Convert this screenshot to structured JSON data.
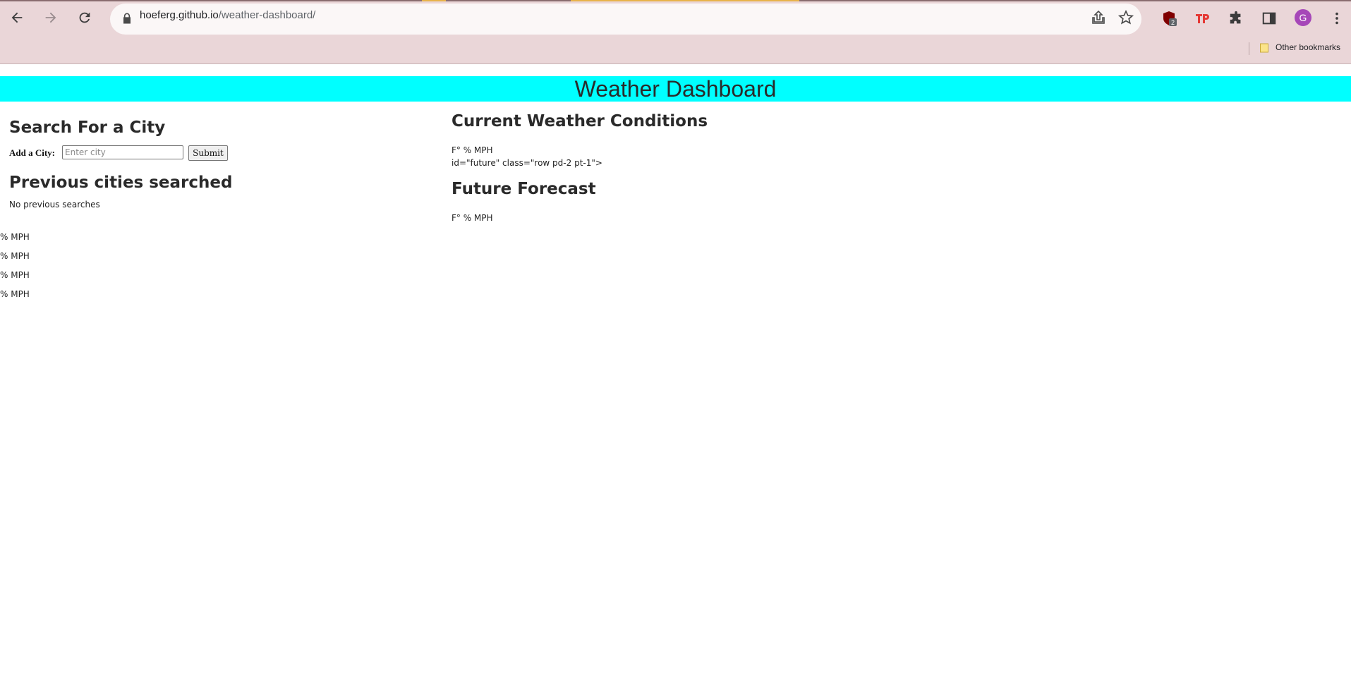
{
  "browser": {
    "url_host": "hoeferg.github.io",
    "url_path": "/weather-dashboard/",
    "profile_initial": "G",
    "bookmarks_label": "Other bookmarks",
    "extension_badge": "2",
    "icons": {
      "back": "back-arrow-icon",
      "forward": "forward-arrow-icon",
      "reload": "reload-icon",
      "lock": "lock-icon",
      "share": "share-icon",
      "star": "bookmark-star-icon",
      "ublock": "ublock-icon",
      "tp": "tp-extension-icon",
      "extensions": "puzzle-icon",
      "sidepanel": "side-panel-icon",
      "menu": "kebab-menu-icon",
      "folder": "folder-icon"
    },
    "colors": {
      "frame": "#ead6d8",
      "omnibox": "#fbf7f7",
      "avatar": "#a647b8"
    }
  },
  "page": {
    "title": "Weather Dashboard",
    "banner_color": "#00ffff",
    "search": {
      "heading": "Search For a City",
      "label": "Add a City:",
      "placeholder": "Enter city",
      "value": "",
      "submit_label": "Submit"
    },
    "history": {
      "heading": "Previous cities searched",
      "empty_text": "No previous searches"
    },
    "stray_lines": [
      "% MPH",
      "% MPH",
      "% MPH",
      "% MPH"
    ],
    "current": {
      "heading": "Current Weather Conditions",
      "line1": "F° % MPH",
      "line2": "id=\"future\" class=\"row pd-2 pt-1\">"
    },
    "future": {
      "heading": "Future Forecast",
      "line1": "F° % MPH"
    }
  }
}
